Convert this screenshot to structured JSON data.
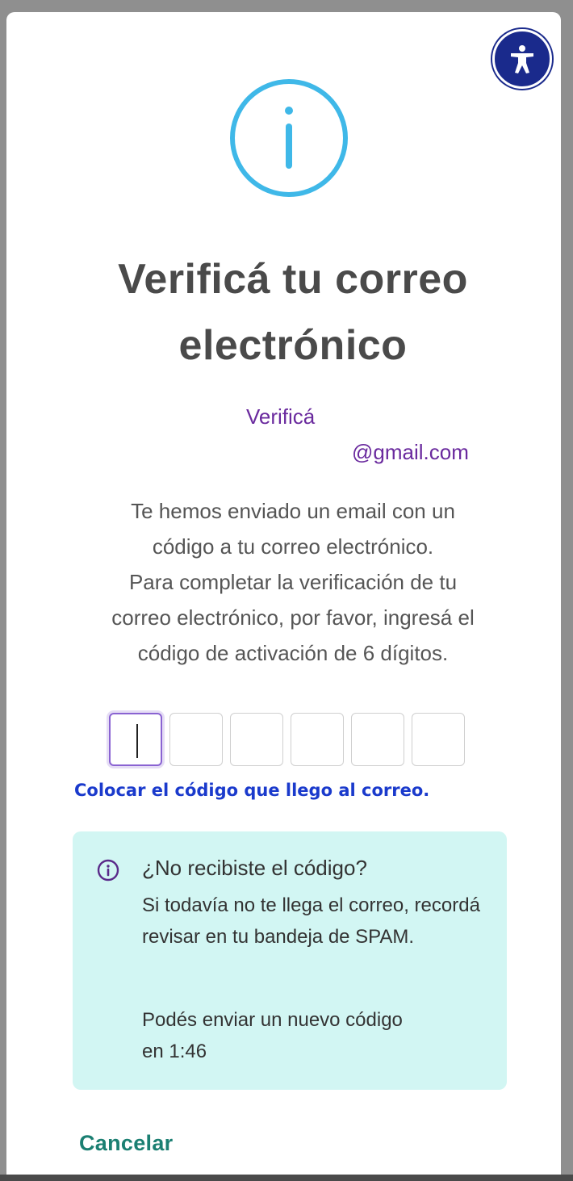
{
  "title": "Verificá tu correo electrónico",
  "email": {
    "prefix": "Verificá",
    "suffix": "@gmail.com"
  },
  "instructions": [
    "Te hemos enviado un email con un",
    "código a tu correo electrónico.",
    "Para completar la verificación de tu",
    "correo electrónico, por favor, ingresá el",
    "código de activación de 6 dígitos."
  ],
  "code_hint": "Colocar el código que llego al correo.",
  "info_panel": {
    "heading": "¿No recibiste el código?",
    "text": "Si todavía no te llega el correo, recordá revisar en tu bandeja de SPAM.",
    "resend_line1": "Podés enviar un nuevo código",
    "resend_line2": "en 1:46"
  },
  "cancel_label": "Cancelar",
  "icons": {
    "accessibility": "accessibility-icon",
    "info_large": "info-icon",
    "info_small": "info-circle-icon"
  },
  "colors": {
    "title": "#4a4a4a",
    "email": "#6a2a9e",
    "hint": "#1a3acc",
    "info_panel_bg": "#d2f6f3",
    "info_icon": "#3fb8e8",
    "cancel": "#1b7f72",
    "accessibility_bg": "#1a2a8c"
  }
}
